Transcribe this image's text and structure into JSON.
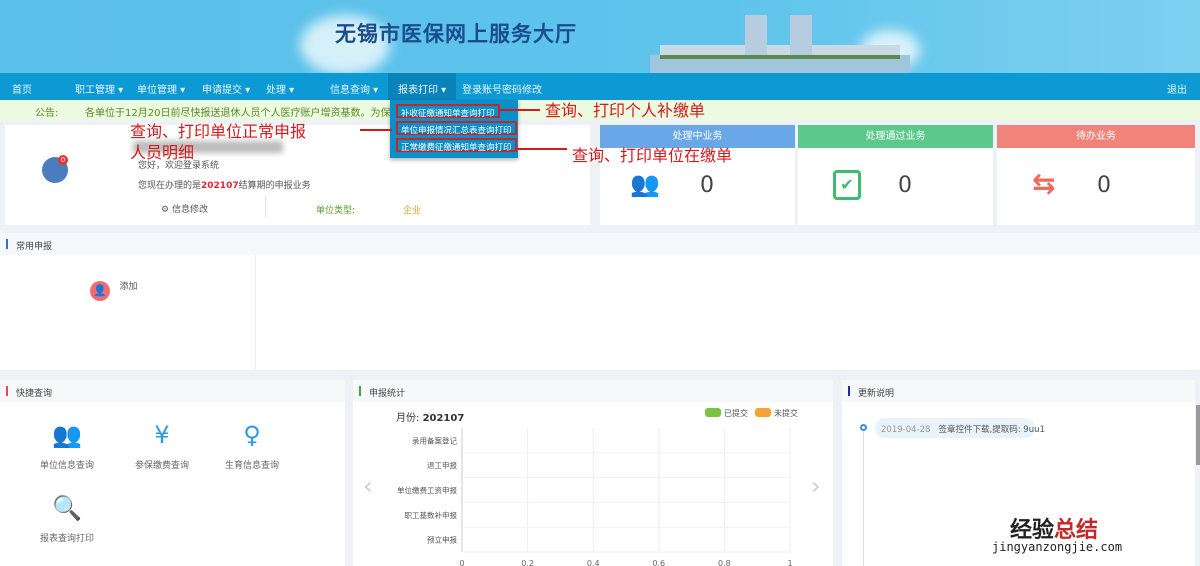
{
  "header": {
    "title": "无锡市医保网上服务大厅"
  },
  "nav": {
    "items": [
      "首页",
      "职工管理 ▾",
      "单位管理 ▾",
      "申请提交 ▾",
      "处理 ▾",
      "信息查询 ▾",
      "报表打印 ▾",
      "登录账号密码修改"
    ],
    "logout": "退出"
  },
  "notice": {
    "label": "公告:",
    "text": "各单位于12月20日前尽快报送退休人员个人医疗账户增资基数。为保障社"
  },
  "dropdown": {
    "items": [
      "补收征缴通知单查询打印",
      "单位申报情况汇总表查询打印",
      "正常缴费征缴通知单查询打印"
    ]
  },
  "annotations": {
    "a1": "查询、打印个人补缴单",
    "a2_line1": "查询、打印单位正常申报",
    "a2_line2": "人员明细",
    "a3": "查询、打印单位在缴单"
  },
  "welcome": {
    "greeting": "您好，欢迎登录系统",
    "period_prefix": "您现在办理的是",
    "period": "202107",
    "period_suffix": "结算期的申报业务",
    "edit": "信息修改",
    "type_label": "单位类型:",
    "type_value": "企业",
    "badge": "0"
  },
  "cards": [
    {
      "title": "处理中业务",
      "count": "0",
      "color": "#6aa7e8"
    },
    {
      "title": "处理通过业务",
      "count": "0",
      "color": "#5cc98a"
    },
    {
      "title": "待办业务",
      "count": "0",
      "color": "#f0837a"
    }
  ],
  "common": {
    "title": "常用申报",
    "add": "添加"
  },
  "quick": {
    "title": "快捷查询",
    "items": [
      "单位信息查询",
      "参保缴费查询",
      "生育信息查询",
      "报表查询打印"
    ]
  },
  "stats": {
    "title": "申报统计",
    "month_label": "月份:",
    "month": "202107"
  },
  "updates": {
    "title": "更新说明",
    "items": [
      {
        "date": "2019-04-28",
        "text": "签章控件下载,提取码: 9uu1"
      }
    ]
  },
  "watermark": {
    "cn1": "经验",
    "cn2": "总结",
    "url": "jingyanzongjie.com"
  },
  "chart_data": {
    "type": "bar",
    "orientation": "horizontal",
    "categories": [
      "录用备案登记",
      "退工申报",
      "单位缴费工资申报",
      "职工基数补申报",
      "预立申报"
    ],
    "series": [
      {
        "name": "已提交",
        "color": "#7dc242",
        "values": [
          0,
          0,
          0,
          0,
          0
        ]
      },
      {
        "name": "未提交",
        "color": "#f7a234",
        "values": [
          0,
          0,
          0,
          0,
          0
        ]
      }
    ],
    "xticks": [
      "0",
      "0.2",
      "0.4",
      "0.6",
      "0.8",
      "1"
    ],
    "xlim": [
      0,
      1
    ],
    "legend": "top-right"
  }
}
